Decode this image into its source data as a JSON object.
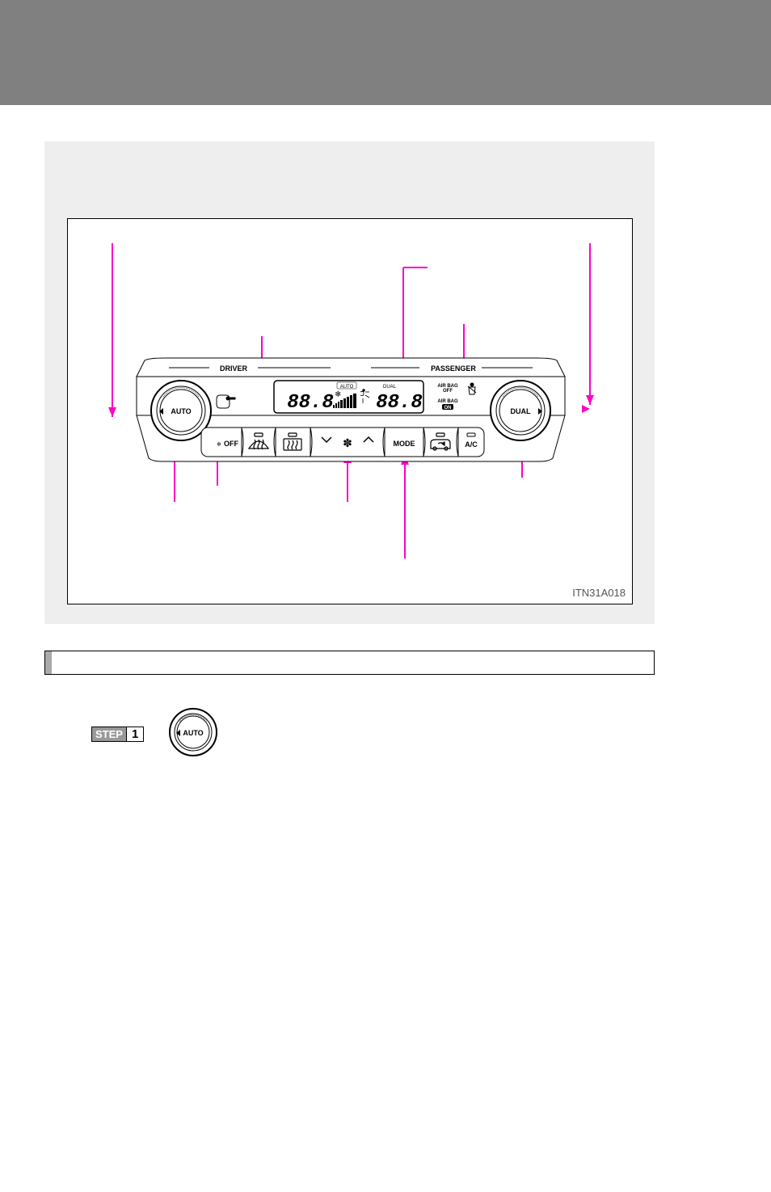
{
  "header": {},
  "diagram": {
    "code": "ITN31A018",
    "panel_labels": {
      "driver": "DRIVER",
      "passenger": "PASSENGER",
      "auto_knob": "AUTO",
      "dual_knob": "DUAL",
      "off_btn": "OFF",
      "mode_btn": "MODE",
      "ac_btn": "A/C",
      "airbag_off": "AIR BAG OFF",
      "airbag_on": "AIR BAG ON",
      "lcd_auto": "AUTO",
      "lcd_dual": "DUAL",
      "lcd_left": "88.8",
      "lcd_right": "88.8"
    }
  },
  "step": {
    "label": "STEP",
    "number": "1",
    "knob": "AUTO"
  }
}
